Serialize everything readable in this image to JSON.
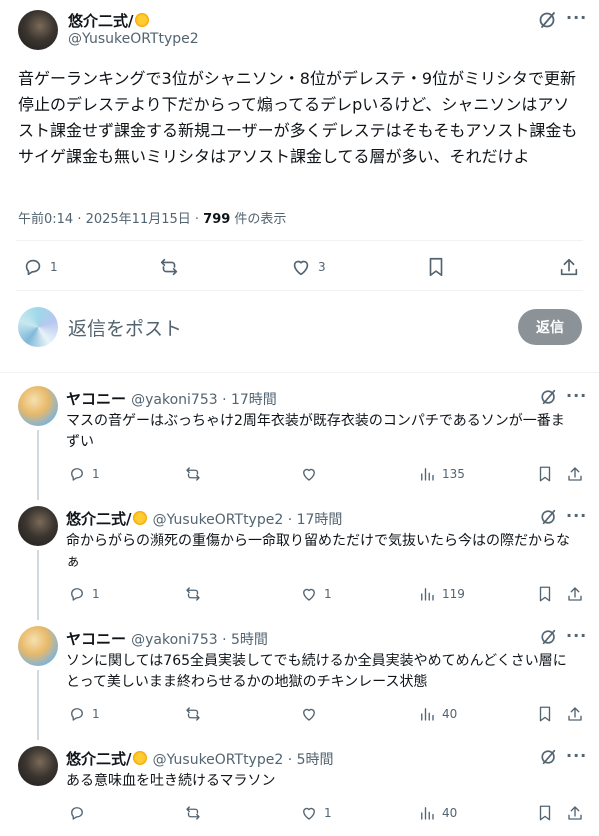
{
  "main_post": {
    "author_name": "悠介二式/",
    "handle": "@YusukeORTtype2",
    "text": "音ゲーランキングで3位がシャニソン・8位がデレステ・9位がミリシタで更新停止のデレステより下だからって煽ってるデレpいるけど、シャニソンはアソスト課金せず課金する新規ユーザーが多くデレステはそもそもアソスト課金もサイゲ課金も無いミリシタはアソスト課金してる層が多い、それだけよ",
    "timestamp": "午前0:14 · 2025年11月15日 · ",
    "views_count": "799",
    "views_label": " 件の表示",
    "reply_count": "1",
    "like_count": "3"
  },
  "composer": {
    "placeholder": "返信をポスト",
    "button_label": "返信"
  },
  "replies": [
    {
      "author_name": "ヤコニー",
      "handle": "@yakoni753 · 17時間",
      "text": "マスの音ゲーはぶっちゃけ2周年衣装が既存衣装のコンパチであるソンが一番まずい",
      "reply_count": "1",
      "like_count": "",
      "view_count": "135"
    },
    {
      "author_name": "悠介二式/",
      "handle": "@YusukeORTtype2 · 17時間",
      "text": "命からがらの瀕死の重傷から一命取り留めただけで気抜いたら今はの際だからなぁ",
      "reply_count": "1",
      "like_count": "1",
      "view_count": "119"
    },
    {
      "author_name": "ヤコニー",
      "handle": "@yakoni753 · 5時間",
      "text": "ソンに関しては765全員実装してでも続けるか全員実装やめてめんどくさい層にとって美しいまま終わらせるかの地獄のチキンレース状態",
      "reply_count": "1",
      "like_count": "",
      "view_count": "40"
    },
    {
      "author_name": "悠介二式/",
      "handle": "@YusukeORTtype2 · 5時間",
      "text": "ある意味血を吐き続けるマラソン",
      "reply_count": "",
      "like_count": "1",
      "view_count": "40"
    }
  ],
  "icons": [
    "grok-icon",
    "more-icon",
    "reply-icon",
    "repost-icon",
    "like-icon",
    "bookmark-icon",
    "share-icon",
    "views-icon",
    "sun-badge-icon"
  ],
  "colors": {
    "text": "#0f1419",
    "secondary": "#536471",
    "divider": "#eff3f4",
    "reply_button": "#8b9298"
  }
}
